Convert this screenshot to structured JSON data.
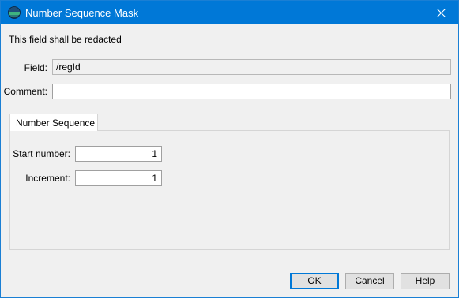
{
  "window": {
    "title": "Number Sequence Mask",
    "icon": "app-globe-icon",
    "close_icon": "close-icon",
    "accent_color": "#0078d7"
  },
  "info_text": "This field shall be redacted",
  "field": {
    "label": "Field:",
    "value": "/regId"
  },
  "comment": {
    "label": "Comment:",
    "value": ""
  },
  "tabs": [
    {
      "label": "Number Sequence",
      "selected": true
    }
  ],
  "sequence": {
    "start_label": "Start number:",
    "start_value": "1",
    "increment_label": "Increment:",
    "increment_value": "1"
  },
  "buttons": {
    "ok": "OK",
    "cancel": "Cancel",
    "help_mnemonic": "H",
    "help_rest": "elp"
  }
}
